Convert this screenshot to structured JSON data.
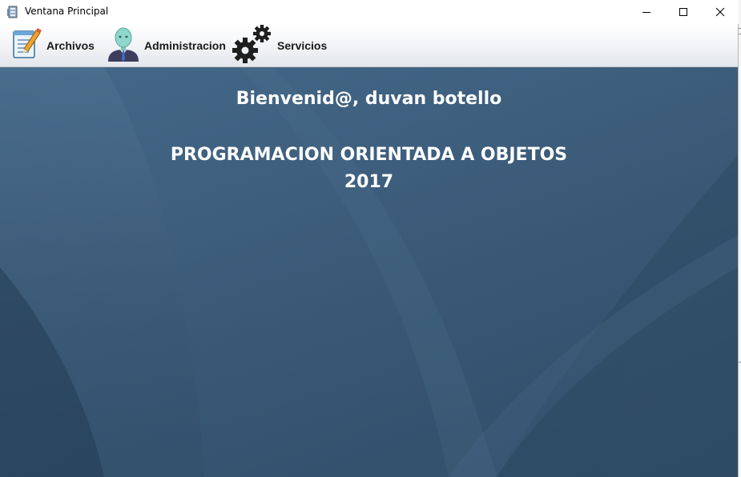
{
  "window": {
    "title": "Ventana Principal",
    "icon": "app-window-icon"
  },
  "controls": {
    "minimize_icon": "minimize-icon",
    "maximize_icon": "maximize-icon",
    "close_icon": "close-icon"
  },
  "menu": {
    "items": [
      {
        "label": "Archivos",
        "icon": "document-edit-icon"
      },
      {
        "label": "Administracion",
        "icon": "user-avatar-icon"
      },
      {
        "label": "Servicios",
        "icon": "gears-icon"
      }
    ]
  },
  "main": {
    "welcome": "Bienvenid@, duvan botello",
    "course": "PROGRAMACION ORIENTADA A OBJETOS",
    "year": "2017",
    "background_color": "#3b5a76"
  }
}
